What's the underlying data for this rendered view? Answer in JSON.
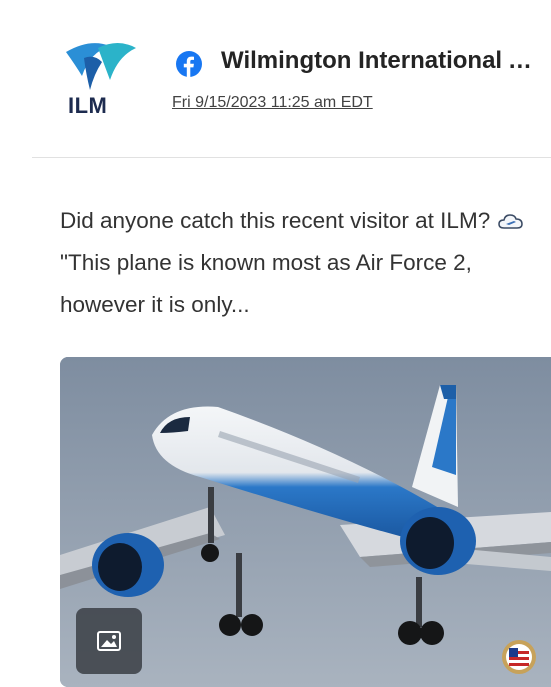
{
  "source": {
    "logo_text": "ILM",
    "logo_icon": "ilm-airport-logo",
    "platform_icon": "facebook-icon",
    "name": "Wilmington International Airport",
    "date": "Fri 9/15/2023 11:25 am EDT"
  },
  "post": {
    "text_before_emoji": "Did anyone catch this recent visitor at ILM?",
    "emoji": "cloud-plane-emoji",
    "text_after_emoji": "\"This plane is known most as Air Force 2, however it is only..."
  },
  "media": {
    "subject": "Air Force 2 Boeing 757 on approach",
    "badge_icon": "image-icon",
    "watermark_icon": "usa-seal-icon"
  },
  "colors": {
    "facebook_blue": "#1877f2",
    "ilm_teal": "#2bb3c9",
    "ilm_navy": "#1d2b4f",
    "plane_blue": "#1f6fc4",
    "sky": "#8d9aa9"
  }
}
